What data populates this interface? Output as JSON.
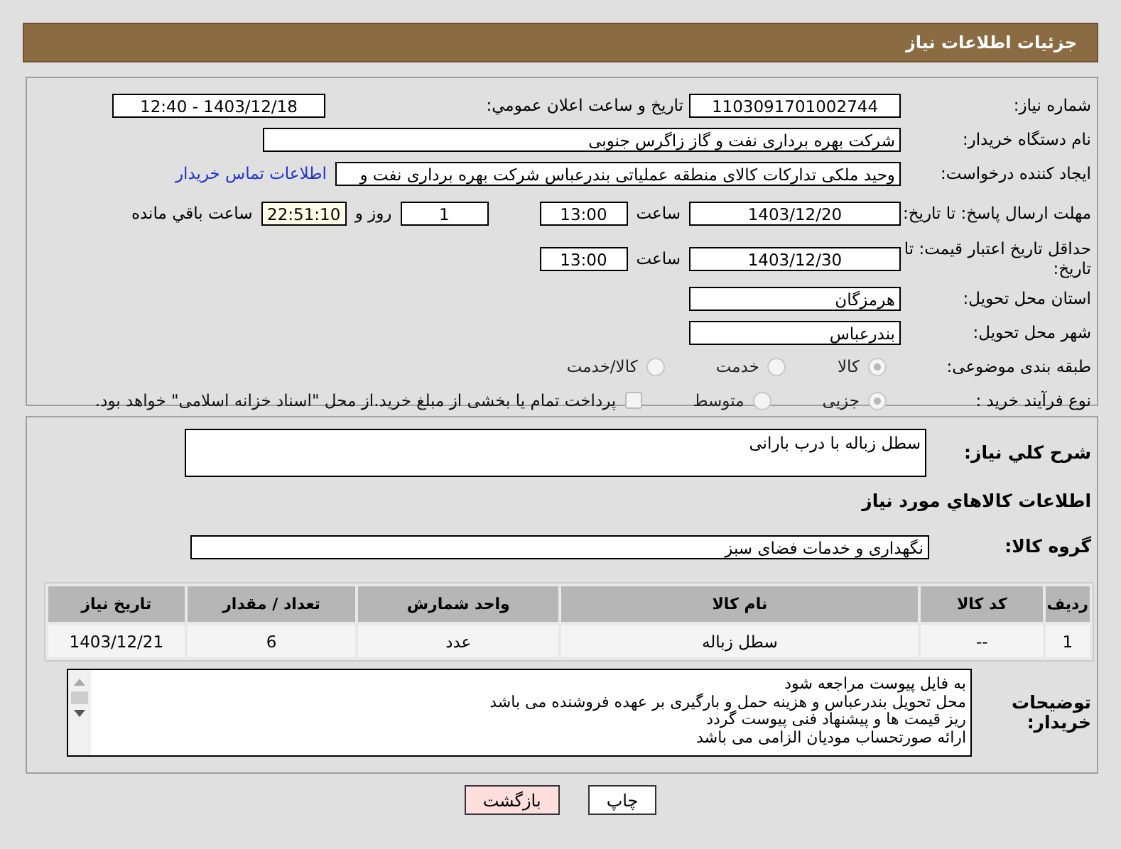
{
  "header": {
    "title": "جزئیات اطلاعات نیاز"
  },
  "details": {
    "need_number": {
      "label": "شماره نیاز:",
      "value": "1103091701002744"
    },
    "announce": {
      "label": "تاریخ و ساعت اعلان عمومي:",
      "value": "1403/12/18 - 12:40"
    },
    "buyer": {
      "label": "نام دستگاه خریدار:",
      "value": "شرکت بهره برداری نفت و گاز زاگرس جنوبی"
    },
    "requester": {
      "label": "ایجاد کننده درخواست:",
      "value": "وحید ملکی تدارکات کالای منطقه عملیاتی بندرعباس شرکت بهره برداری نفت و",
      "link": "اطلاعات تماس خریدار"
    },
    "reply_deadline": {
      "label": "مهلت ارسال پاسخ: تا تاریخ:",
      "date": "1403/12/20",
      "time_label": "ساعت",
      "time": "13:00",
      "days": "1",
      "days_label": "روز و",
      "remaining": "22:51:10",
      "remaining_label": "ساعت باقي مانده"
    },
    "price_validity": {
      "label": "حداقل تاریخ اعتبار قیمت: تا تاریخ:",
      "date": "1403/12/30",
      "time_label": "ساعت",
      "time": "13:00"
    },
    "province": {
      "label": "استان محل تحویل:",
      "value": "هرمزگان"
    },
    "city": {
      "label": "شهر محل تحویل:",
      "value": "بندرعباس"
    },
    "category": {
      "label": "طبقه بندی موضوعی:",
      "options": [
        {
          "label": "کالا",
          "selected": true
        },
        {
          "label": "خدمت",
          "selected": false
        },
        {
          "label": "کالا/خدمت",
          "selected": false
        }
      ]
    },
    "purchase_process": {
      "label": "نوع فرآیند خرید :",
      "options": [
        {
          "label": "جزیی",
          "selected": true
        },
        {
          "label": "متوسط",
          "selected": false
        }
      ],
      "payment": {
        "label": "پرداخت تمام یا بخشی از مبلغ خرید.از محل \"اسناد خزانه اسلامی\" خواهد بود.",
        "checked": false
      }
    }
  },
  "items": {
    "description": {
      "label": "شرح کلي نیاز:",
      "value": "سطل زباله با درب بارانی"
    },
    "heading": "اطلاعات کالاهاي مورد نیاز",
    "group": {
      "label": "گروه کالا:",
      "value": "نگهداری و خدمات فضای سبز"
    },
    "table": {
      "columns": [
        "ردیف",
        "کد کالا",
        "نام کالا",
        "واحد شمارش",
        "تعداد / مقدار",
        "تاریخ نیاز"
      ],
      "rows": [
        [
          "1",
          "--",
          "سطل زباله",
          "عدد",
          "6",
          "1403/12/21"
        ]
      ]
    },
    "notes": {
      "label": "توضیحات خریدار:",
      "lines": [
        "به فایل پیوست مراجعه شود",
        "محل تحویل بندرعباس و هزینه حمل و بارگیری بر عهده فروشنده می باشد",
        "ریز قیمت ها و پیشنهاد فنی پیوست گردد",
        "ارائه صورتحساب مودیان الزامی می باشد"
      ]
    }
  },
  "buttons": [
    {
      "label": "چاپ",
      "kind": "print"
    },
    {
      "label": "بازگشت",
      "kind": "back"
    }
  ]
}
